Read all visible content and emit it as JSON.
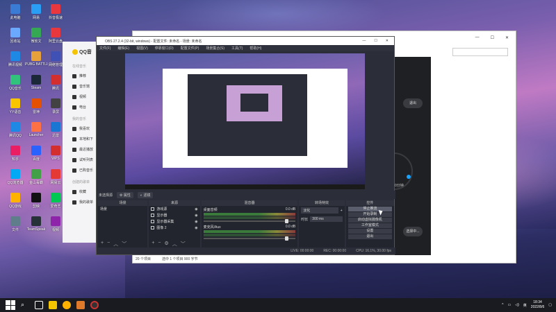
{
  "desktop": {
    "icons": [
      {
        "label": "此电脑",
        "color": "#3a7bd5"
      },
      {
        "label": "网易",
        "color": "#2a9df4"
      },
      {
        "label": "抖音极速",
        "color": "#e8383d"
      },
      {
        "label": "回收站",
        "color": "#6aa9ff"
      },
      {
        "label": "微软文",
        "color": "#34a853"
      },
      {
        "label": "阿里云盘",
        "color": "#e8383d"
      },
      {
        "label": "腾讯视频",
        "color": "#1e88e5"
      },
      {
        "label": "PUBG BATTLEGR",
        "color": "#e6a13a"
      },
      {
        "label": "网络管理",
        "color": "#3f51b5"
      },
      {
        "label": "QQ音乐",
        "color": "#31c27c"
      },
      {
        "label": "Steam",
        "color": "#1b2838"
      },
      {
        "label": "腾讯",
        "color": "#d32f2f"
      },
      {
        "label": "YY语音",
        "color": "#f9c400"
      },
      {
        "label": "雷神",
        "color": "#e65100"
      },
      {
        "label": "录屏",
        "color": "#424242"
      },
      {
        "label": "腾讯QQ",
        "color": "#1e88e5"
      },
      {
        "label": "Launcher",
        "color": "#ff7043"
      },
      {
        "label": "迅雷",
        "color": "#1976d2"
      },
      {
        "label": "知乎",
        "color": "#e91e63"
      },
      {
        "label": "百度",
        "color": "#2962ff"
      },
      {
        "label": "WPS",
        "color": "#d32f2f"
      },
      {
        "label": "QQ浏览器",
        "color": "#03a9f4"
      },
      {
        "label": "金山毒霸",
        "color": "#43a047"
      },
      {
        "label": "网易云",
        "color": "#e53935"
      },
      {
        "label": "QQ游戏",
        "color": "#ffb300"
      },
      {
        "label": "剪映",
        "color": "#111111"
      },
      {
        "label": "爱奇艺",
        "color": "#00c853"
      },
      {
        "label": "文件",
        "color": "#607d8b"
      },
      {
        "label": "TeamSpeak",
        "color": "#263238"
      },
      {
        "label": "视频",
        "color": "#8e24aa"
      }
    ]
  },
  "qq_window": {
    "logo": "QQ音",
    "section_1": "在线音乐",
    "items_1": [
      "推荐",
      "音乐馆",
      "视频",
      "电台"
    ],
    "section_2": "我的音乐",
    "items_2": [
      "我喜欢",
      "本地和下",
      "最近播放",
      "试听列表",
      "已购音乐"
    ],
    "section_3": "创建的歌单",
    "items_3": [
      "收藏",
      "我的歌单"
    ]
  },
  "dark_window": {
    "button_top": "退出",
    "button_bottom": "选择中...",
    "ring_label": "0分钟"
  },
  "explorer": {
    "status_count": "20 个项目",
    "status_selected": "选中 1 个项目 900 字节"
  },
  "obs": {
    "title": "OBS 27.2.4 (32-bit, windows) - 配置文件: 未命名 - 场景: 未命名",
    "menu": [
      "文件(F)",
      "编辑(E)",
      "视图(V)",
      "停靠窗口(D)",
      "配置文件(P)",
      "场景集合(S)",
      "工具(T)",
      "帮助(H)"
    ],
    "scenebar_label": "未选择源",
    "scenebar_props": "属性",
    "scenebar_filters": "滤镜",
    "docks": {
      "scenes": {
        "title": "场景",
        "items": [
          "场景"
        ]
      },
      "sources": {
        "title": "来源",
        "items": [
          "游戏源",
          "显示器",
          "显示器采集",
          "图像 2"
        ]
      },
      "mixer": {
        "title": "混音器",
        "channels": [
          {
            "name": "桌面音频",
            "db": "0.0 dB"
          },
          {
            "name": "麦克风/Aux",
            "db": "0.0 dB"
          }
        ]
      },
      "transitions": {
        "title": "转场特效",
        "type": "淡化",
        "duration_label": "时长",
        "duration": "300 ms"
      },
      "controls": {
        "title": "控件",
        "buttons": [
          "停止推流",
          "开始录制",
          "启动虚拟摄像机",
          "工作室模式",
          "设置",
          "退出"
        ]
      }
    },
    "status": {
      "live": "LIVE: 00:00:00",
      "rec": "REC: 00:00:00",
      "cpu": "CPU: 16.1%, 30.00 fps"
    }
  },
  "taskbar": {
    "time": "18:34",
    "date": "2022/8/6",
    "lang": "英"
  }
}
